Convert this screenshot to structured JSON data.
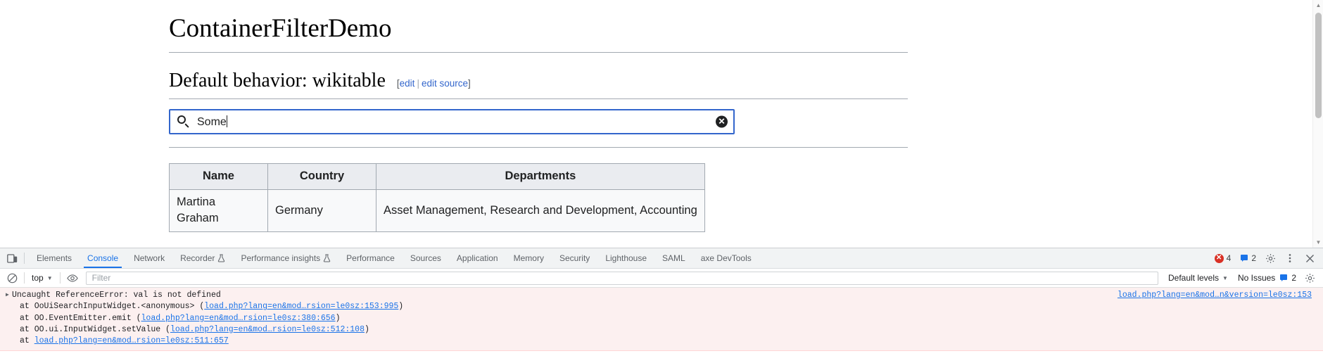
{
  "page": {
    "title": "ContainerFilterDemo",
    "section": {
      "heading": "Default behavior: wikitable",
      "edit_open": "[",
      "edit_label": "edit",
      "edit_pipe": "|",
      "edit_source_label": "edit source",
      "edit_close": "]"
    },
    "search": {
      "icon": "search-icon",
      "value": "Some",
      "placeholder": "",
      "clear_icon": "clear-circle-icon",
      "clear_glyph": "✕"
    },
    "table": {
      "headers": [
        "Name",
        "Country",
        "Departments"
      ],
      "rows": [
        {
          "name": "Martina Graham",
          "country": "Germany",
          "departments": "Asset Management, Research and Development, Accounting"
        }
      ]
    }
  },
  "devtools": {
    "device_toolbar_icon": "device-toolbar-icon",
    "tabs": [
      {
        "label": "Elements",
        "active": false,
        "flask": false
      },
      {
        "label": "Console",
        "active": true,
        "flask": false
      },
      {
        "label": "Network",
        "active": false,
        "flask": false
      },
      {
        "label": "Recorder",
        "active": false,
        "flask": true
      },
      {
        "label": "Performance insights",
        "active": false,
        "flask": true
      },
      {
        "label": "Performance",
        "active": false,
        "flask": false
      },
      {
        "label": "Sources",
        "active": false,
        "flask": false
      },
      {
        "label": "Application",
        "active": false,
        "flask": false
      },
      {
        "label": "Memory",
        "active": false,
        "flask": false
      },
      {
        "label": "Security",
        "active": false,
        "flask": false
      },
      {
        "label": "Lighthouse",
        "active": false,
        "flask": false
      },
      {
        "label": "SAML",
        "active": false,
        "flask": false
      },
      {
        "label": "axe DevTools",
        "active": false,
        "flask": false
      }
    ],
    "status": {
      "error_count": "4",
      "warning_count": "2",
      "error_color": "#d93025"
    },
    "settings_icon": "gear-icon",
    "more_icon": "kebab-menu-icon",
    "close_icon": "close-icon",
    "console_toolbar": {
      "clear_icon": "clear-console-icon",
      "context": "top",
      "context_caret": "▼",
      "eye_icon": "live-expression-eye-icon",
      "filter_placeholder": "Filter",
      "filter_value": "",
      "levels_label": "Default levels",
      "levels_caret": "▼",
      "issues_label": "No Issues",
      "issues_count": "2",
      "issues_icon": "issues-flag-icon",
      "settings_icon": "console-settings-gear-icon"
    },
    "console": {
      "error": {
        "toggle": "▶",
        "message": "Uncaught ReferenceError: val is not defined",
        "source_link": "load.php?lang=en&mod…n&version=le0sz:153",
        "stack": [
          {
            "prefix": "at OoUiSearchInputWidget.<anonymous> (",
            "link": "load.php?lang=en&mod…rsion=le0sz:153:995",
            "suffix": ")"
          },
          {
            "prefix": "at OO.EventEmitter.emit (",
            "link": "load.php?lang=en&mod…rsion=le0sz:380:656",
            "suffix": ")"
          },
          {
            "prefix": "at OO.ui.InputWidget.setValue (",
            "link": "load.php?lang=en&mod…rsion=le0sz:512:108",
            "suffix": ")"
          },
          {
            "prefix": "at ",
            "link": "load.php?lang=en&mod…rsion=le0sz:511:657",
            "suffix": ""
          }
        ]
      }
    }
  },
  "scrollbar": {
    "up_arrow": "▲",
    "down_arrow": "▼"
  }
}
